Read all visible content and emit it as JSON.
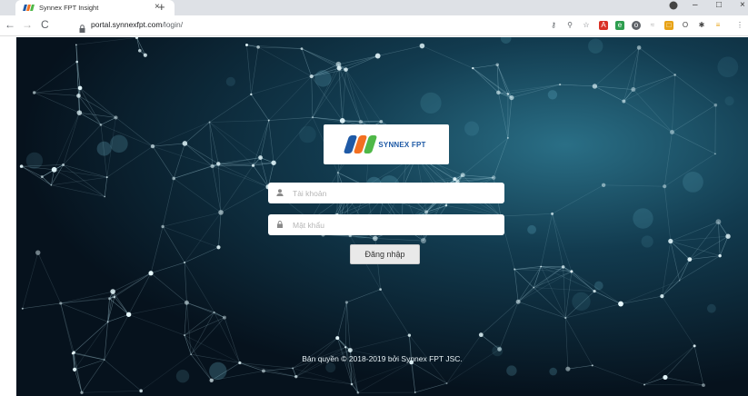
{
  "browser": {
    "tab_title": "Synnex FPT Insight",
    "tab_close": "×",
    "new_tab": "+",
    "url_host": "portal.synnexfpt.com",
    "url_path": "/login/"
  },
  "login": {
    "brand": "SYNNEX FPT",
    "username_placeholder": "Tài khoản",
    "password_placeholder": "Mật khẩu",
    "submit_label": "Đăng nhập"
  },
  "footer": {
    "copyright": "Bản quyền © 2018-2019 bởi Synnex FPT JSC."
  },
  "colors": {
    "fpt_blue": "#1f5aa6",
    "fpt_orange": "#f37021",
    "fpt_green": "#4fb848"
  }
}
